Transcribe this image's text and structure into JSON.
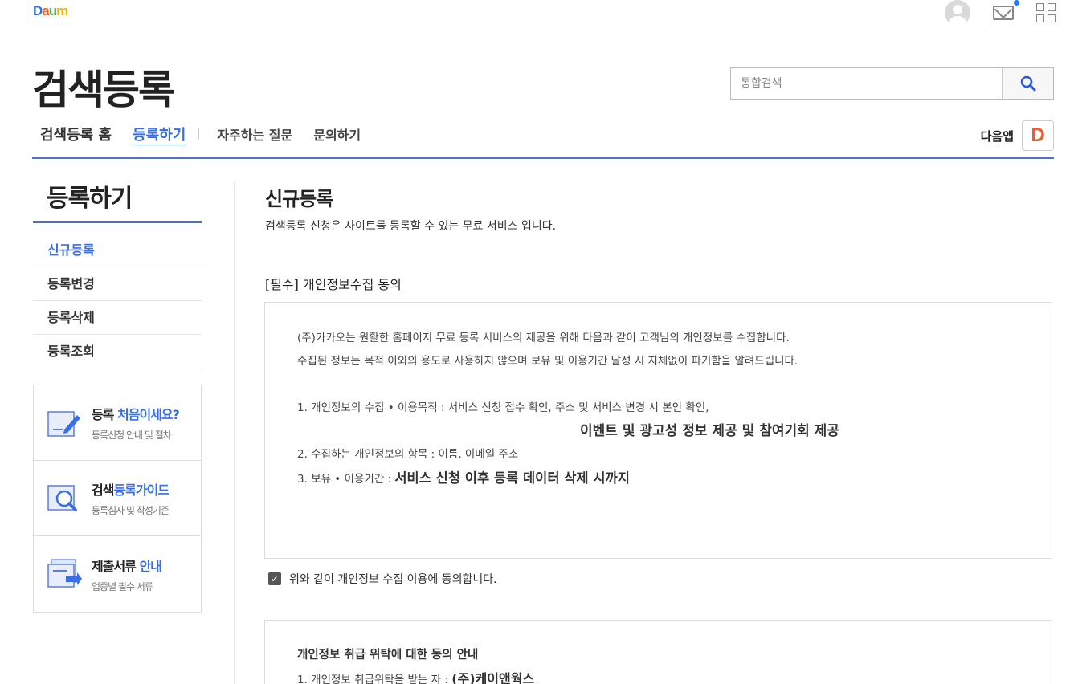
{
  "top": {
    "logo_letters": [
      "D",
      "a",
      "u",
      "m"
    ],
    "icons": [
      "user-avatar-icon",
      "mail-icon",
      "apps-grid-icon"
    ]
  },
  "header": {
    "title": "검색등록",
    "search_placeholder": "통합검색",
    "nav": [
      {
        "label": "검색등록 홈"
      },
      {
        "label": "등록하기",
        "active": true
      },
      {
        "label": "자주하는 질문"
      },
      {
        "label": "문의하기"
      }
    ],
    "daum_app_label": "다음앱",
    "daum_app_badge": "D"
  },
  "sidebar": {
    "title": "등록하기",
    "items": [
      {
        "label": "신규등록",
        "active": true
      },
      {
        "label": "등록변경"
      },
      {
        "label": "등록삭제"
      },
      {
        "label": "등록조회"
      }
    ],
    "banners": [
      {
        "title_prefix": "등록 ",
        "title_highlight": "처음이세요?",
        "title_suffix": "",
        "sub": "등록신청 안내 및 절차"
      },
      {
        "title_prefix": "검색",
        "title_highlight": "등록가이드",
        "title_suffix": "",
        "sub": "등록심사 및 작성기준"
      },
      {
        "title_prefix": "제출서류 ",
        "title_highlight": "안내",
        "title_suffix": "",
        "sub": "업종별 필수 서류"
      }
    ]
  },
  "main": {
    "title": "신규등록",
    "desc": "검색등록 신청은 사이트를 등록할 수 있는 무료 서비스 입니다.",
    "section_title": "[필수] 개인정보수집 동의",
    "terms": {
      "line1": "(주)카카오는 원활한 홈페이지 무료 등록 서비스의 제공을 위해 다음과 같이 고객님의 개인정보를 수집합니다.",
      "line2": "수집된 정보는 목적 이외의 용도로 사용하지 않으며 보유 및 이용기간 달성 시 지체없이 파기함을 알려드립니다.",
      "item1": "1. 개인정보의 수집 • 이용목적 : 서비스 신청 접수 확인, 주소 및 서비스 변경 시 본인 확인,",
      "item1_cont": "이벤트 및 광고성 정보 제공 및 참여기회 제공",
      "item2": "2. 수집하는 개인정보의 항목 : 이름, 이메일 주소",
      "item3_prefix": "3. 보유 • 이용기간 : ",
      "item3_value": "서비스 신청 이후 등록 데이터 삭제 시까지"
    },
    "agree_label": "위와 같이 개인정보 수집 이용에 동의합니다.",
    "agree_checked": true,
    "terms2": {
      "head": "개인정보 취급 위탁에 대한 동의 안내",
      "item1_prefix": "1. 개인정보 취급위탁을 받는 자 : ",
      "item1_value": "(주)케이앤웍스"
    }
  }
}
